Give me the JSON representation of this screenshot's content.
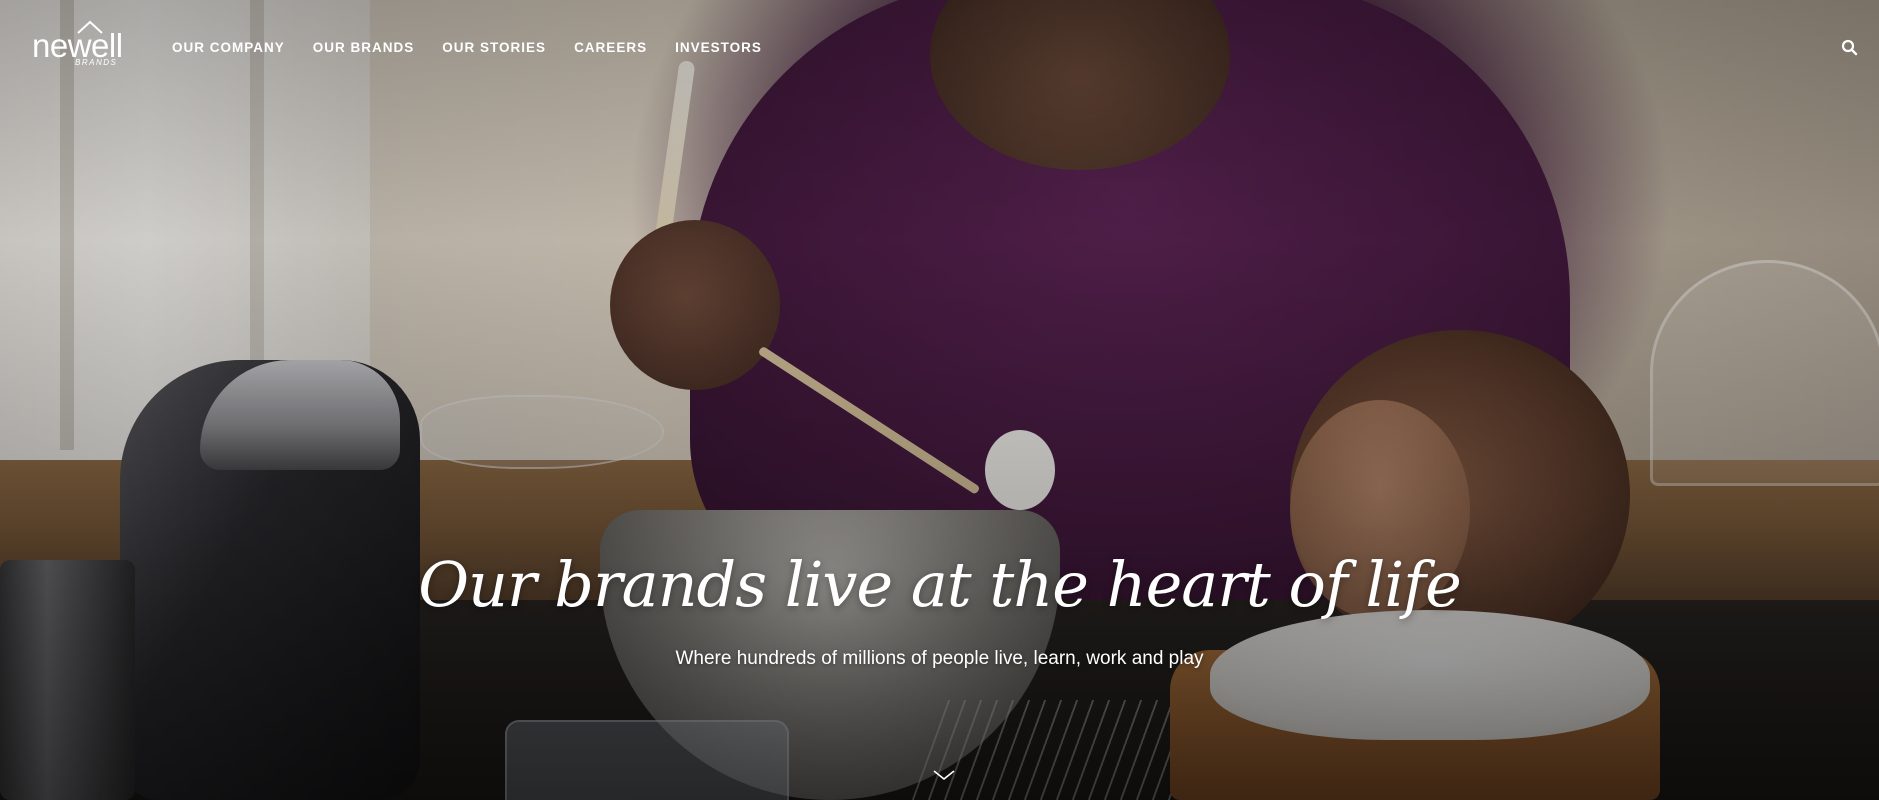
{
  "logo": {
    "wordmark": "newell",
    "subtitle": "BRANDS"
  },
  "nav": {
    "items": [
      {
        "label": "OUR COMPANY"
      },
      {
        "label": "OUR BRANDS"
      },
      {
        "label": "OUR STORIES"
      },
      {
        "label": "CAREERS"
      },
      {
        "label": "INVESTORS"
      }
    ]
  },
  "icons": {
    "search": "search-icon",
    "scroll": "chevron-down-icon"
  },
  "hero": {
    "headline": "Our brands live at the heart of life",
    "subheadline": "Where hundreds of millions of people live, learn, work and play"
  },
  "colors": {
    "text": "#ffffff",
    "shirt": "#461a40"
  }
}
